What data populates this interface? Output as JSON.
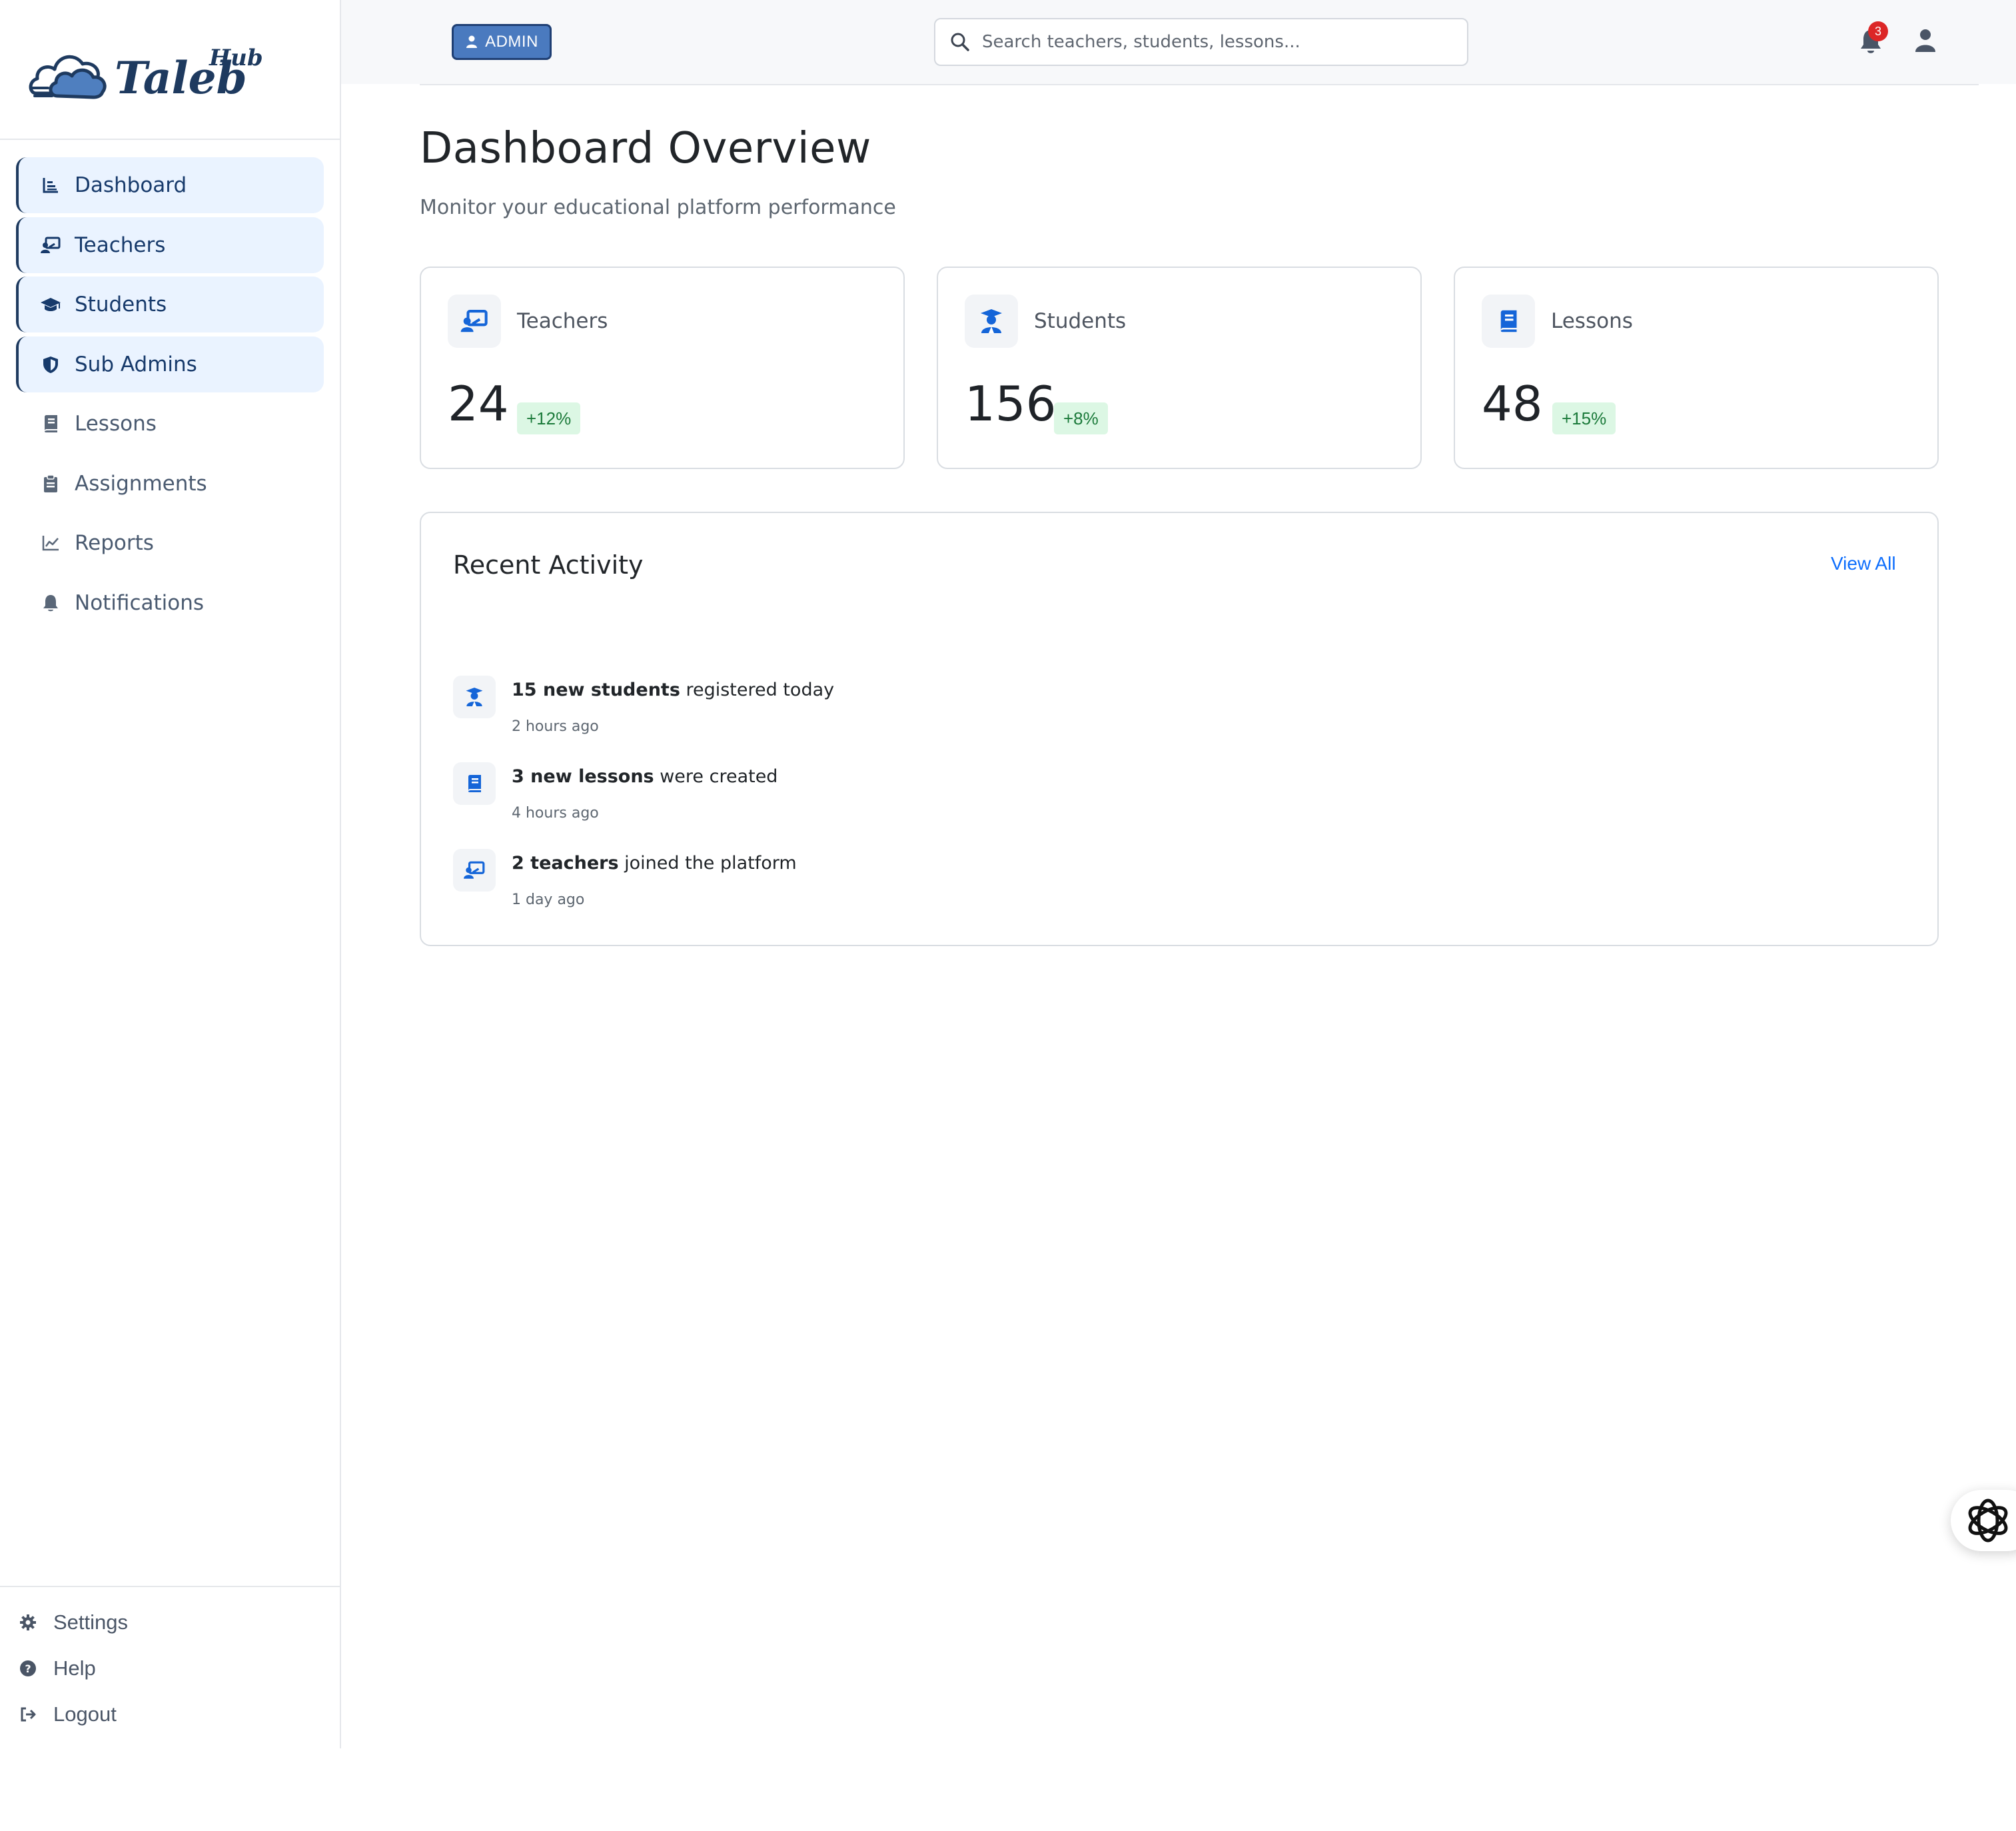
{
  "brand": {
    "name_main": "Taleb",
    "name_super": "Hub"
  },
  "sidebar": {
    "items": [
      {
        "label": "Dashboard",
        "icon": "chart-bar-icon",
        "highlight": true
      },
      {
        "label": "Teachers",
        "icon": "chalkboard-teacher-icon",
        "highlight": true
      },
      {
        "label": "Students",
        "icon": "graduation-cap-icon",
        "highlight": true
      },
      {
        "label": "Sub Admins",
        "icon": "shield-icon",
        "highlight": true
      },
      {
        "label": "Lessons",
        "icon": "book-icon",
        "highlight": false
      },
      {
        "label": "Assignments",
        "icon": "clipboard-icon",
        "highlight": false
      },
      {
        "label": "Reports",
        "icon": "line-chart-icon",
        "highlight": false
      },
      {
        "label": "Notifications",
        "icon": "bell-icon",
        "highlight": false
      }
    ],
    "footer": [
      {
        "label": "Settings",
        "icon": "gear-icon"
      },
      {
        "label": "Help",
        "icon": "question-circle-icon"
      },
      {
        "label": "Logout",
        "icon": "logout-icon"
      }
    ]
  },
  "header": {
    "role_badge": "ADMIN",
    "search_placeholder": "Search teachers, students, lessons...",
    "notification_count": "3"
  },
  "main": {
    "title": "Dashboard Overview",
    "subtitle": "Monitor your educational platform performance",
    "stats": [
      {
        "label": "Teachers",
        "value": "24",
        "change": "+12%",
        "icon": "chalkboard-teacher-icon"
      },
      {
        "label": "Students",
        "value": "156",
        "change": "+8%",
        "icon": "user-graduate-icon"
      },
      {
        "label": "Lessons",
        "value": "48",
        "change": "+15%",
        "icon": "book-icon"
      }
    ],
    "activity": {
      "title": "Recent Activity",
      "view_all": "View All",
      "items": [
        {
          "bold": "15 new students",
          "rest": " registered today",
          "time": "2 hours ago",
          "icon": "user-graduate-icon"
        },
        {
          "bold": "3 new lessons",
          "rest": " were created",
          "time": "4 hours ago",
          "icon": "book-icon"
        },
        {
          "bold": "2 teachers",
          "rest": " joined the platform",
          "time": "1 day ago",
          "icon": "chalkboard-teacher-icon"
        }
      ]
    }
  },
  "colors": {
    "primary": "#173a6b",
    "accent": "#1565d8",
    "highlight_bg": "#eaf3ff",
    "success_bg": "#dcf7e4",
    "success_text": "#1b7a3a",
    "badge": "#dc2626",
    "link": "#0d6efd"
  }
}
